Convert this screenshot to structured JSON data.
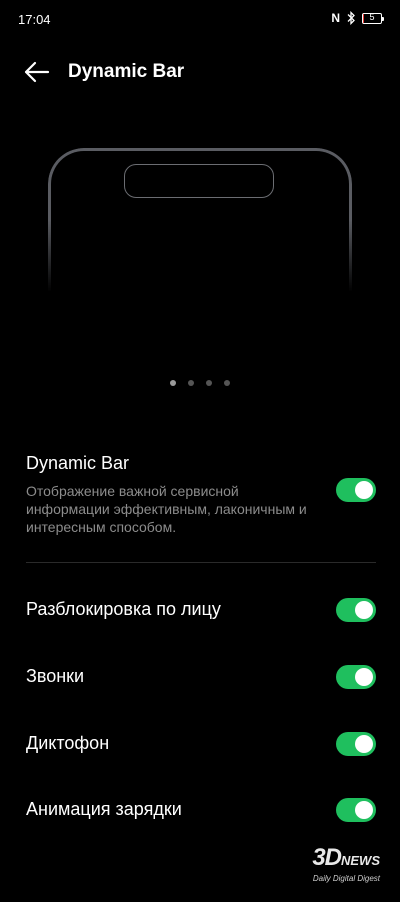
{
  "status_bar": {
    "time": "17:04",
    "nfc_label": "N",
    "battery_text": "5",
    "battery_level_percent": 5,
    "battery_color": "#e53935"
  },
  "header": {
    "title": "Dynamic Bar",
    "back_icon": "arrow-left-icon"
  },
  "preview": {
    "page_count": 4,
    "active_page": 1
  },
  "settings": [
    {
      "title": "Dynamic Bar",
      "description": "Отображение важной сервисной информации эффективным, лаконичным и интересным способом.",
      "enabled": true
    },
    {
      "title": "Разблокировка по лицу",
      "enabled": true
    },
    {
      "title": "Звонки",
      "enabled": true
    },
    {
      "title": "Диктофон",
      "enabled": true
    },
    {
      "title": "Анимация зарядки",
      "enabled": true
    }
  ],
  "watermark": {
    "logo": "3D",
    "logo_sub": "NEWS",
    "tagline": "Daily Digital Digest"
  },
  "colors": {
    "toggle_on": "#1fbf5e",
    "background": "#000000"
  }
}
